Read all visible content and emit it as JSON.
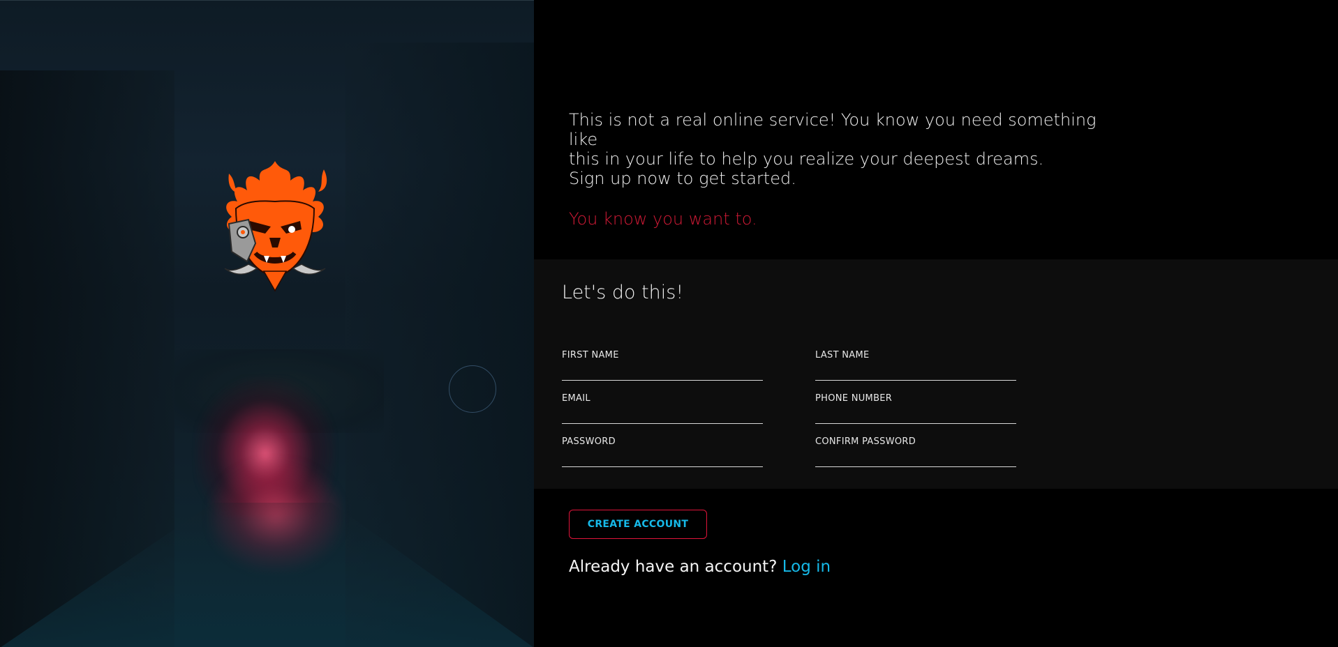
{
  "intro": {
    "line1": "This is not a real online service! You know you need something like",
    "line2": "this in your life to help you realize your deepest dreams.",
    "line3": "Sign up now to get started.",
    "teaser": "You know you want to."
  },
  "form": {
    "title": "Let's do this!",
    "fields": [
      {
        "label": "FIRST NAME",
        "value": ""
      },
      {
        "label": "LAST NAME",
        "value": ""
      },
      {
        "label": "EMAIL",
        "value": ""
      },
      {
        "label": "PHONE NUMBER",
        "value": ""
      },
      {
        "label": "PASSWORD",
        "value": ""
      },
      {
        "label": "CONFIRM PASSWORD",
        "value": ""
      }
    ]
  },
  "actions": {
    "create_label": "CREATE ACCOUNT",
    "login_prompt": "Already have an account?",
    "login_link": "Log in"
  },
  "hero": {
    "logo_icon": "samurai-demon-logo-icon"
  },
  "colors": {
    "accent_cyan": "#16b9e8",
    "accent_red": "#d11a36",
    "logo_orange": "#ff5a0a",
    "form_bg": "#0d0d0d"
  }
}
